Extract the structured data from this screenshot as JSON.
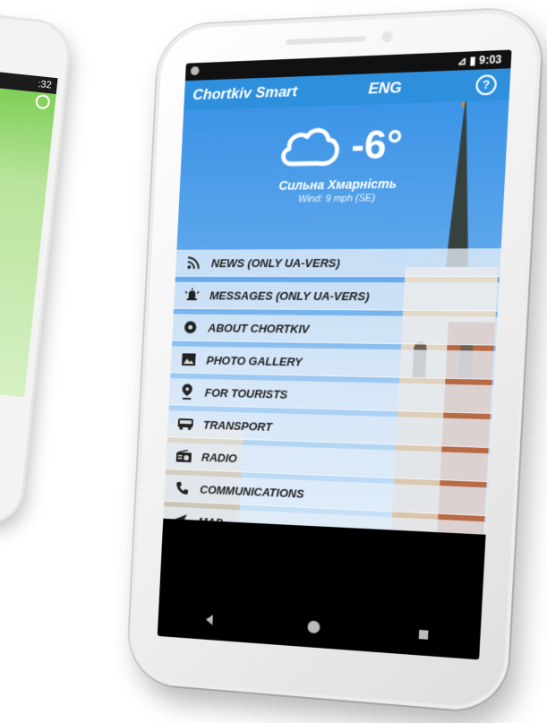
{
  "left_phone": {
    "status_time": ":32"
  },
  "status_bar": {
    "time": "9:03",
    "icons_label": "⊿ ▮"
  },
  "app_bar": {
    "title": "Chortkiv Smart",
    "language": "ENG",
    "help_icon": "?"
  },
  "weather": {
    "icon": "cloud-icon",
    "temperature": "-6°",
    "condition": "Сильна Хмарність",
    "wind": "Wind: 9 mph (SE)"
  },
  "menu": {
    "items": [
      {
        "label": "NEWS (ONLY UA-VERS)",
        "icon": "rss-icon"
      },
      {
        "label": "MESSAGES (ONLY UA-VERS)",
        "icon": "alert-icon"
      },
      {
        "label": "ABOUT CHORTKIV",
        "icon": "badge-icon"
      },
      {
        "label": "PHOTO GALLERY",
        "icon": "image-icon"
      },
      {
        "label": "FOR TOURISTS",
        "icon": "pin-icon"
      },
      {
        "label": "TRANSPORT",
        "icon": "bus-icon"
      },
      {
        "label": "RADIO",
        "icon": "radio-icon"
      },
      {
        "label": "COMMUNICATIONS",
        "icon": "phone-icon"
      },
      {
        "label": "MAP",
        "icon": "navigation-icon"
      }
    ]
  },
  "nav_bar": {
    "buttons": [
      "back-icon",
      "home-icon",
      "recents-icon"
    ]
  },
  "colors": {
    "app_bar": "#2e8fdc",
    "sky_top": "#3c94e6",
    "menu_bg": "#e6eef8"
  }
}
